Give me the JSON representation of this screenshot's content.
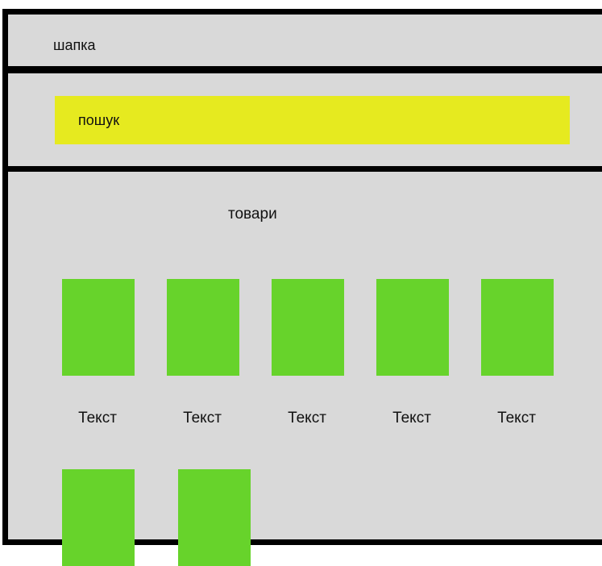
{
  "header": {
    "label": "шапка"
  },
  "search": {
    "label": "пошук",
    "color": "#e6ea1f"
  },
  "products": {
    "title": "товари",
    "tile_color": "#67d32b",
    "items": [
      {
        "label": "Текст"
      },
      {
        "label": "Текст"
      },
      {
        "label": "Текст"
      },
      {
        "label": "Текст"
      },
      {
        "label": "Текст"
      },
      {
        "label": ""
      },
      {
        "label": ""
      }
    ]
  }
}
